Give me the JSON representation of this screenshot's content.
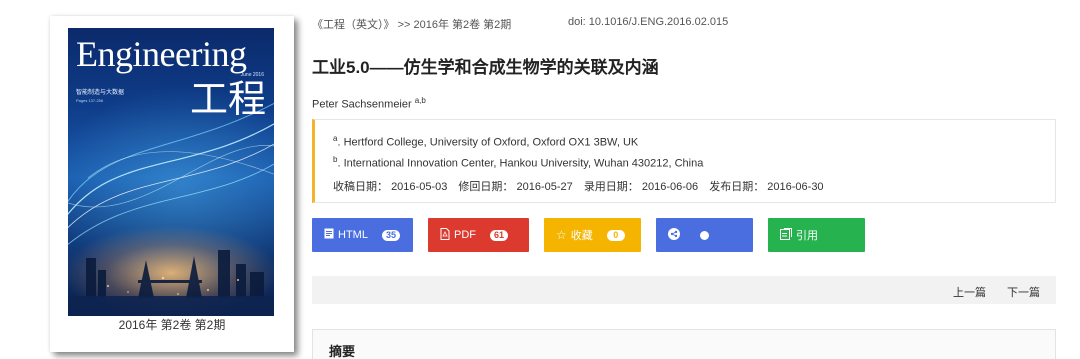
{
  "cover": {
    "title_en": "Engineering",
    "date_small": "June 2016",
    "subtitle_cn": "智能制造与大数据",
    "subtitle_pages": "Pages 137-256",
    "title_cn": "工程",
    "caption": "2016年 第2卷 第2期"
  },
  "header": {
    "breadcrumb_journal": "《工程（英文）》",
    "breadcrumb_sep": ">>",
    "breadcrumb_issue": "2016年 第2卷 第2期",
    "doi": "doi: 10.1016/J.ENG.2016.02.015"
  },
  "article": {
    "title": "工业5.0——仿生学和合成生物学的关联及内涵",
    "author_name": "Peter Sachsenmeier",
    "author_sup": "a,b"
  },
  "affiliations": [
    {
      "sup": "a",
      "text": ". Hertford College, University of Oxford, Oxford OX1 3BW, UK"
    },
    {
      "sup": "b",
      "text": ". International Innovation Center, Hankou University, Wuhan 430212, China"
    }
  ],
  "dates": {
    "received_label": "收稿日期：",
    "received": "2016-05-03",
    "revised_label": "修回日期：",
    "revised": "2016-05-27",
    "accepted_label": "录用日期：",
    "accepted": "2016-06-06",
    "published_label": "发布日期：",
    "published": "2016-06-30"
  },
  "actions": {
    "html_label": "HTML",
    "html_count": "35",
    "pdf_label": "PDF",
    "pdf_count": "61",
    "fav_label": "收藏",
    "fav_count": "0",
    "cite_label": "引用"
  },
  "nav": {
    "prev": "上一篇",
    "next": "下一篇"
  },
  "abstract": {
    "heading": "摘要"
  },
  "colors": {
    "html_button": "#4a6ee0",
    "pdf_button": "#dc3a2f",
    "favorite_button": "#f5b400",
    "share_button": "#4a6ee0",
    "cite_button": "#26b24f",
    "affiliation_accent": "#f5b32b"
  },
  "icons": {
    "html": "document-icon",
    "pdf": "pdf-icon",
    "favorite": "star-icon",
    "share": "share-icon",
    "cite": "quote-icon"
  }
}
